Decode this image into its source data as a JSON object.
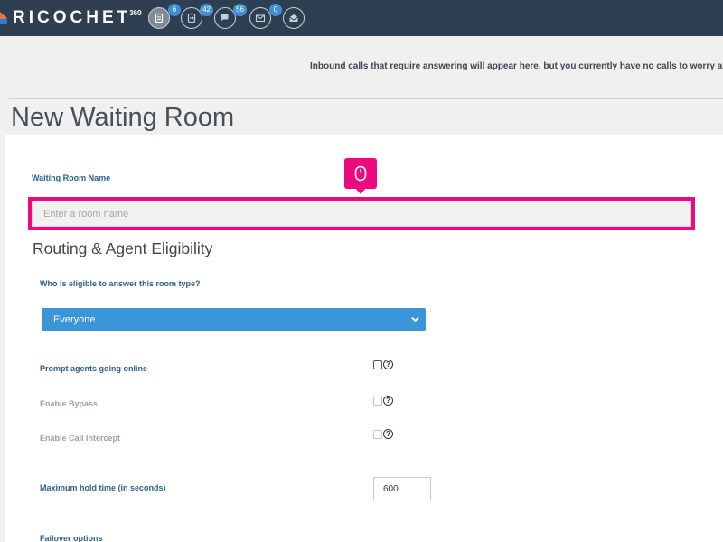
{
  "brand": {
    "name": "RICOCHET",
    "superscript": "360"
  },
  "nav": {
    "items": [
      {
        "name": "documents-icon",
        "badge": "6"
      },
      {
        "name": "transfer-icon",
        "badge": "42"
      },
      {
        "name": "chat-icon",
        "badge": "56"
      },
      {
        "name": "mail-icon",
        "badge": "0"
      },
      {
        "name": "mail-open-icon",
        "badge": ""
      }
    ]
  },
  "notice": "Inbound calls that require answering will appear here, but you currently have no calls to worry about",
  "page": {
    "title": "New Waiting Room"
  },
  "form": {
    "room_name_label": "Waiting Room Name",
    "room_name_placeholder": "Enter a room name",
    "routing_section_title": "Routing & Agent Eligibility",
    "eligible_label": "Who is eligible to answer this room type?",
    "eligible_value": "Everyone",
    "prompt_agents_label": "Prompt agents going online",
    "enable_bypass_label": "Enable Bypass",
    "enable_call_intercept_label": "Enable Call Intercept",
    "max_hold_label": "Maximum hold time (in seconds)",
    "max_hold_value": "600",
    "failover_label": "Failover options"
  },
  "help_glyph": "?",
  "colors": {
    "topbar": "#2f3f52",
    "highlight": "#ec0a7e",
    "select": "#3b95d9",
    "label": "#2e5f8f"
  }
}
